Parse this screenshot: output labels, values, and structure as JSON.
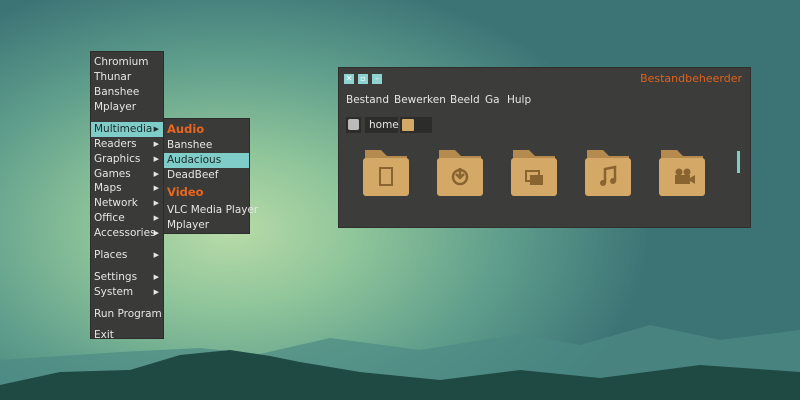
{
  "main_menu": {
    "items": [
      {
        "label": "Chromium"
      },
      {
        "label": "Thunar"
      },
      {
        "label": "Banshee"
      },
      {
        "label": "Mplayer"
      },
      {
        "label": "Multimedia",
        "submenu": true
      },
      {
        "label": "Readers",
        "submenu": true
      },
      {
        "label": "Graphics",
        "submenu": true
      },
      {
        "label": "Games",
        "submenu": true
      },
      {
        "label": "Maps",
        "submenu": true
      },
      {
        "label": "Network",
        "submenu": true
      },
      {
        "label": "Office",
        "submenu": true
      },
      {
        "label": "Accessories",
        "submenu": true
      },
      {
        "label": "Places",
        "submenu": true
      },
      {
        "label": "Settings",
        "submenu": true
      },
      {
        "label": "System",
        "submenu": true
      },
      {
        "label": "Run Program"
      },
      {
        "label": "Exit"
      }
    ]
  },
  "submenu": {
    "audio_header": "Audio",
    "audio": [
      "Banshee",
      "Audacious",
      "DeadBeef"
    ],
    "video_header": "Video",
    "video": [
      "VLC Media Player",
      "Mplayer"
    ]
  },
  "window": {
    "title": "Bestandbeheerder",
    "menu": [
      "Bestand",
      "Bewerken",
      "Beeld",
      "Ga",
      "Hulp"
    ],
    "path": "home",
    "folders": [
      "documents-folder",
      "downloads-folder",
      "pictures-folder",
      "music-folder",
      "videos-folder"
    ]
  },
  "colors": {
    "accent": "#7ecdc9",
    "title": "#e0621e",
    "folder": "#d4a866"
  }
}
